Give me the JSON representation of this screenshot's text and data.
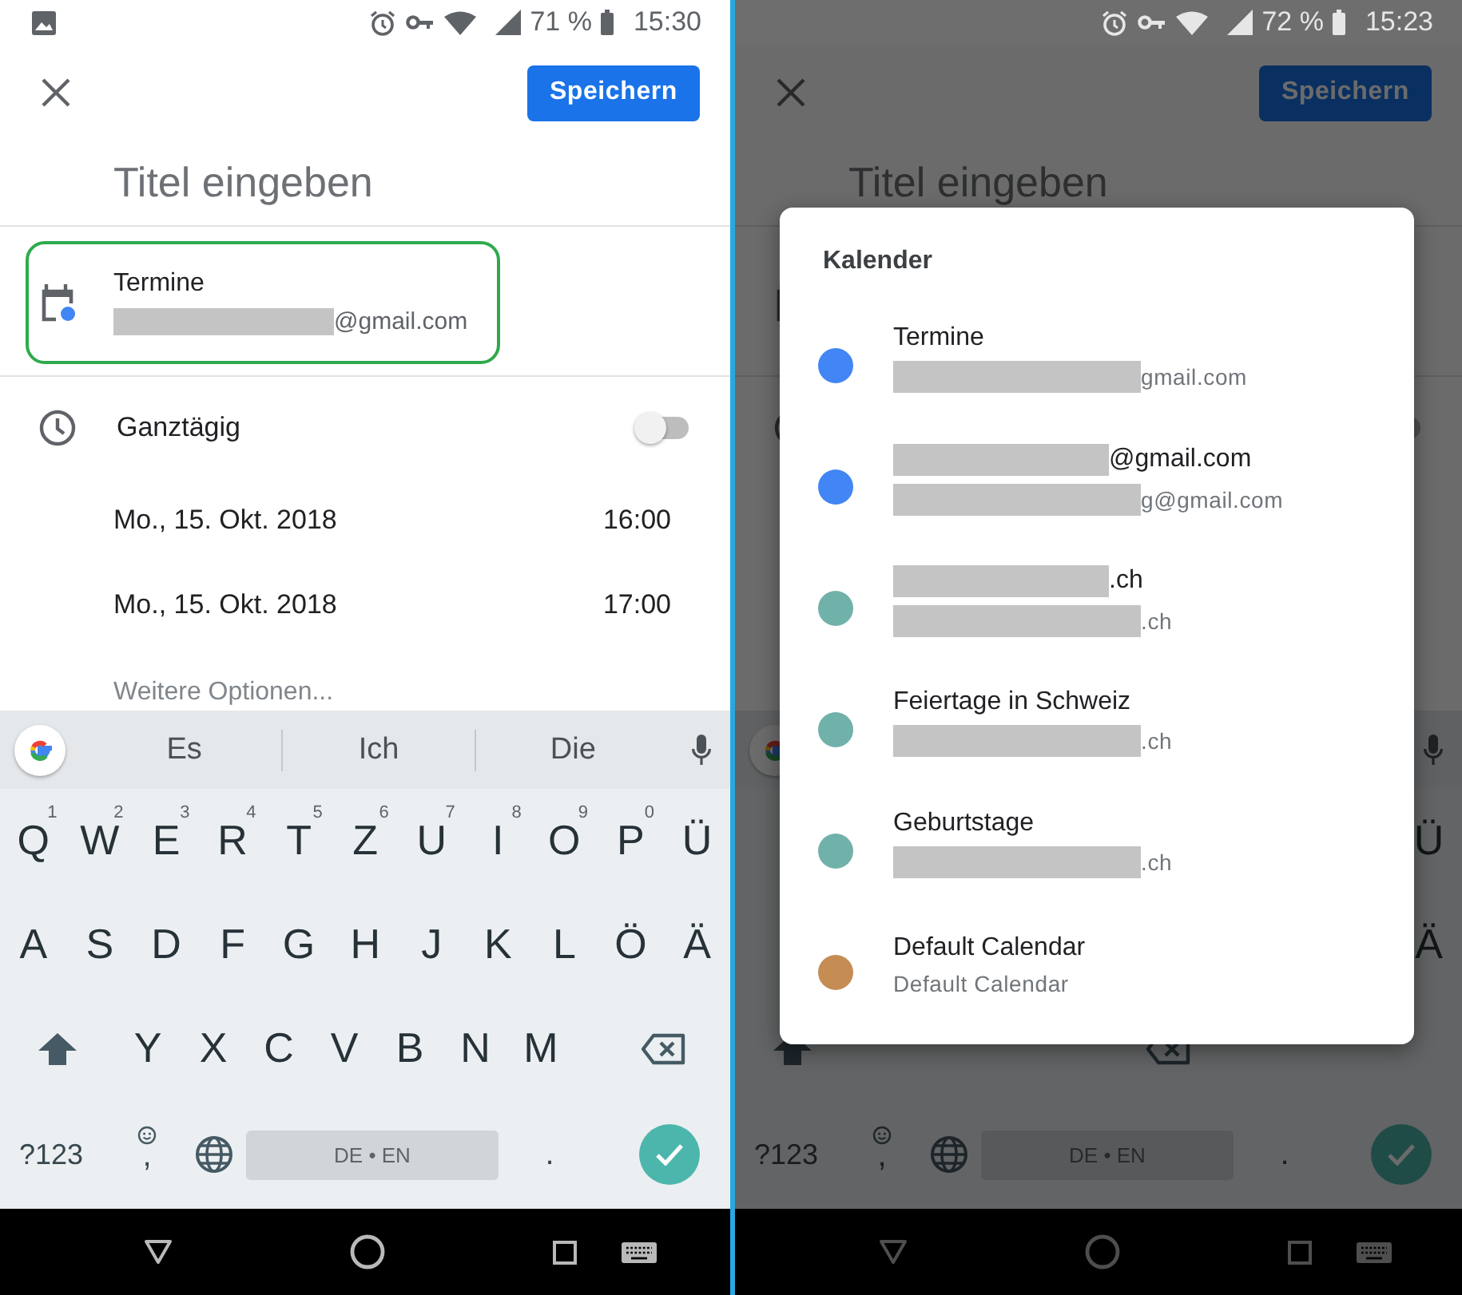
{
  "screens": [
    {
      "dimmed": false,
      "status_bar": {
        "notification": true,
        "battery": "71 %",
        "time": "15:30"
      },
      "save_button": "Speichern",
      "title_field": {
        "placeholder": "Titel eingeben"
      },
      "calendar_row": {
        "highlighted": true,
        "name": "Termine",
        "account": {
          "text": "@gmail.com",
          "redacted": true
        }
      },
      "all_day": {
        "label": "Ganztägig",
        "on": false
      },
      "times": [
        {
          "date": "Mo., 15. Okt. 2018",
          "time": "16:00"
        },
        {
          "date": "Mo., 15. Okt. 2018",
          "time": "17:00"
        }
      ],
      "more_options": "Weitere Optionen...",
      "keyboard": {
        "suggestions": [
          "Es",
          "Ich",
          "Die"
        ],
        "letter_rows": [
          [
            {
              "label": "Q",
              "hint": "1"
            },
            {
              "label": "W",
              "hint": "2"
            },
            {
              "label": "E",
              "hint": "3"
            },
            {
              "label": "R",
              "hint": "4"
            },
            {
              "label": "T",
              "hint": "5"
            },
            {
              "label": "Z",
              "hint": "6"
            },
            {
              "label": "U",
              "hint": "7"
            },
            {
              "label": "I",
              "hint": "8"
            },
            {
              "label": "O",
              "hint": "9"
            },
            {
              "label": "P",
              "hint": "0"
            },
            {
              "label": "Ü"
            }
          ],
          [
            {
              "label": "A"
            },
            {
              "label": "S"
            },
            {
              "label": "D"
            },
            {
              "label": "F"
            },
            {
              "label": "G"
            },
            {
              "label": "H"
            },
            {
              "label": "J"
            },
            {
              "label": "K"
            },
            {
              "label": "L"
            },
            {
              "label": "Ö"
            },
            {
              "label": "Ä"
            }
          ]
        ],
        "bottom_letters": [
          "Y",
          "X",
          "C",
          "V",
          "B",
          "N",
          "M"
        ],
        "symbols_key": "?123",
        "comma_key": ",",
        "space_key": "DE • EN",
        "period_key": "."
      }
    },
    {
      "dimmed": true,
      "status_bar": {
        "notification": false,
        "battery": "72 %",
        "time": "15:23"
      },
      "save_button": "Speichern",
      "title_field": {
        "placeholder": "Titel eingeben"
      },
      "calendar_row": {
        "highlighted": false
      },
      "all_day": {
        "on": false
      },
      "keyboard": {
        "letter_rows": [
          [
            {
              "label": "Ü"
            }
          ],
          [
            {
              "label": "Ä"
            }
          ]
        ],
        "symbols_key": "?123",
        "comma_key": ",",
        "space_key": "DE • EN",
        "period_key": "."
      },
      "dialog": {
        "title": "Kalender",
        "calendars": [
          {
            "color": "#4285f4",
            "name": {
              "text": "Termine",
              "redacted": false
            },
            "account": {
              "text": "gmail.com",
              "redacted": true
            }
          },
          {
            "color": "#4285f4",
            "name": {
              "text": "@gmail.com",
              "redacted": true
            },
            "account": {
              "text": "g@gmail.com",
              "redacted": true
            }
          },
          {
            "color": "#70b1a9",
            "name": {
              "text": ".ch",
              "redacted": true
            },
            "account": {
              "text": ".ch",
              "redacted": true
            }
          },
          {
            "color": "#70b1a9",
            "name": {
              "text": "Feiertage in Schweiz",
              "redacted": false
            },
            "account": {
              "text": ".ch",
              "redacted": true
            }
          },
          {
            "color": "#70b1a9",
            "name": {
              "text": "Geburtstage",
              "redacted": false
            },
            "account": {
              "text": ".ch",
              "redacted": true
            }
          },
          {
            "color": "#c58c54",
            "name": {
              "text": "Default Calendar",
              "redacted": false
            },
            "account": {
              "text": "Default Calendar",
              "redacted": false
            }
          }
        ]
      }
    }
  ]
}
